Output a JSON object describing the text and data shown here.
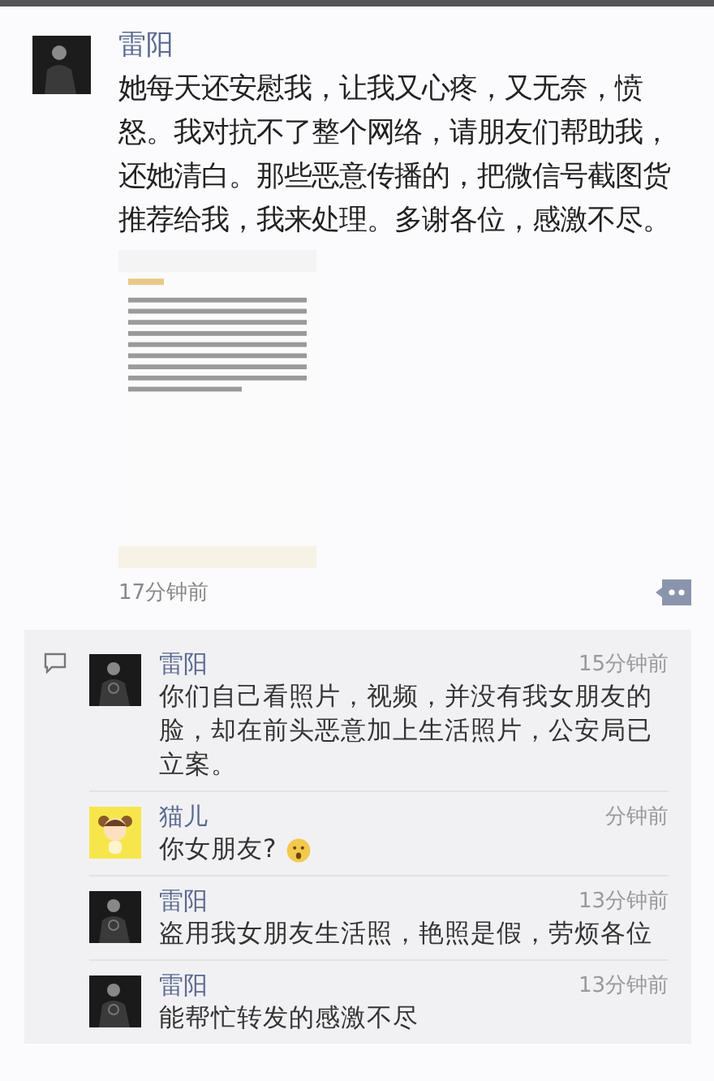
{
  "post": {
    "author": "雷阳",
    "text": "她每天还安慰我，让我又心疼，又无奈，愤怒。我对抗不了整个网络，请朋友们帮助我，还她清白。那些恶意传播的，把微信号截图货推荐给我，我来处理。多谢各位，感激不尽。",
    "time": "17分钟前"
  },
  "comments": [
    {
      "author": "雷阳",
      "kind": "dark",
      "time": "15分钟前",
      "text": "你们自己看照片，视频，并没有我女朋友的脸，却在前头恶意加上生活照片，公安局已立案。"
    },
    {
      "author": "猫儿",
      "kind": "cartoon",
      "time": "分钟前",
      "text": "你女朋友?",
      "emoji": true
    },
    {
      "author": "雷阳",
      "kind": "dark",
      "time": "13分钟前",
      "text": "盗用我女朋友生活照，艳照是假，劳烦各位"
    },
    {
      "author": "雷阳",
      "kind": "dark",
      "time": "13分钟前",
      "text": "能帮忙转发的感激不尽"
    }
  ]
}
